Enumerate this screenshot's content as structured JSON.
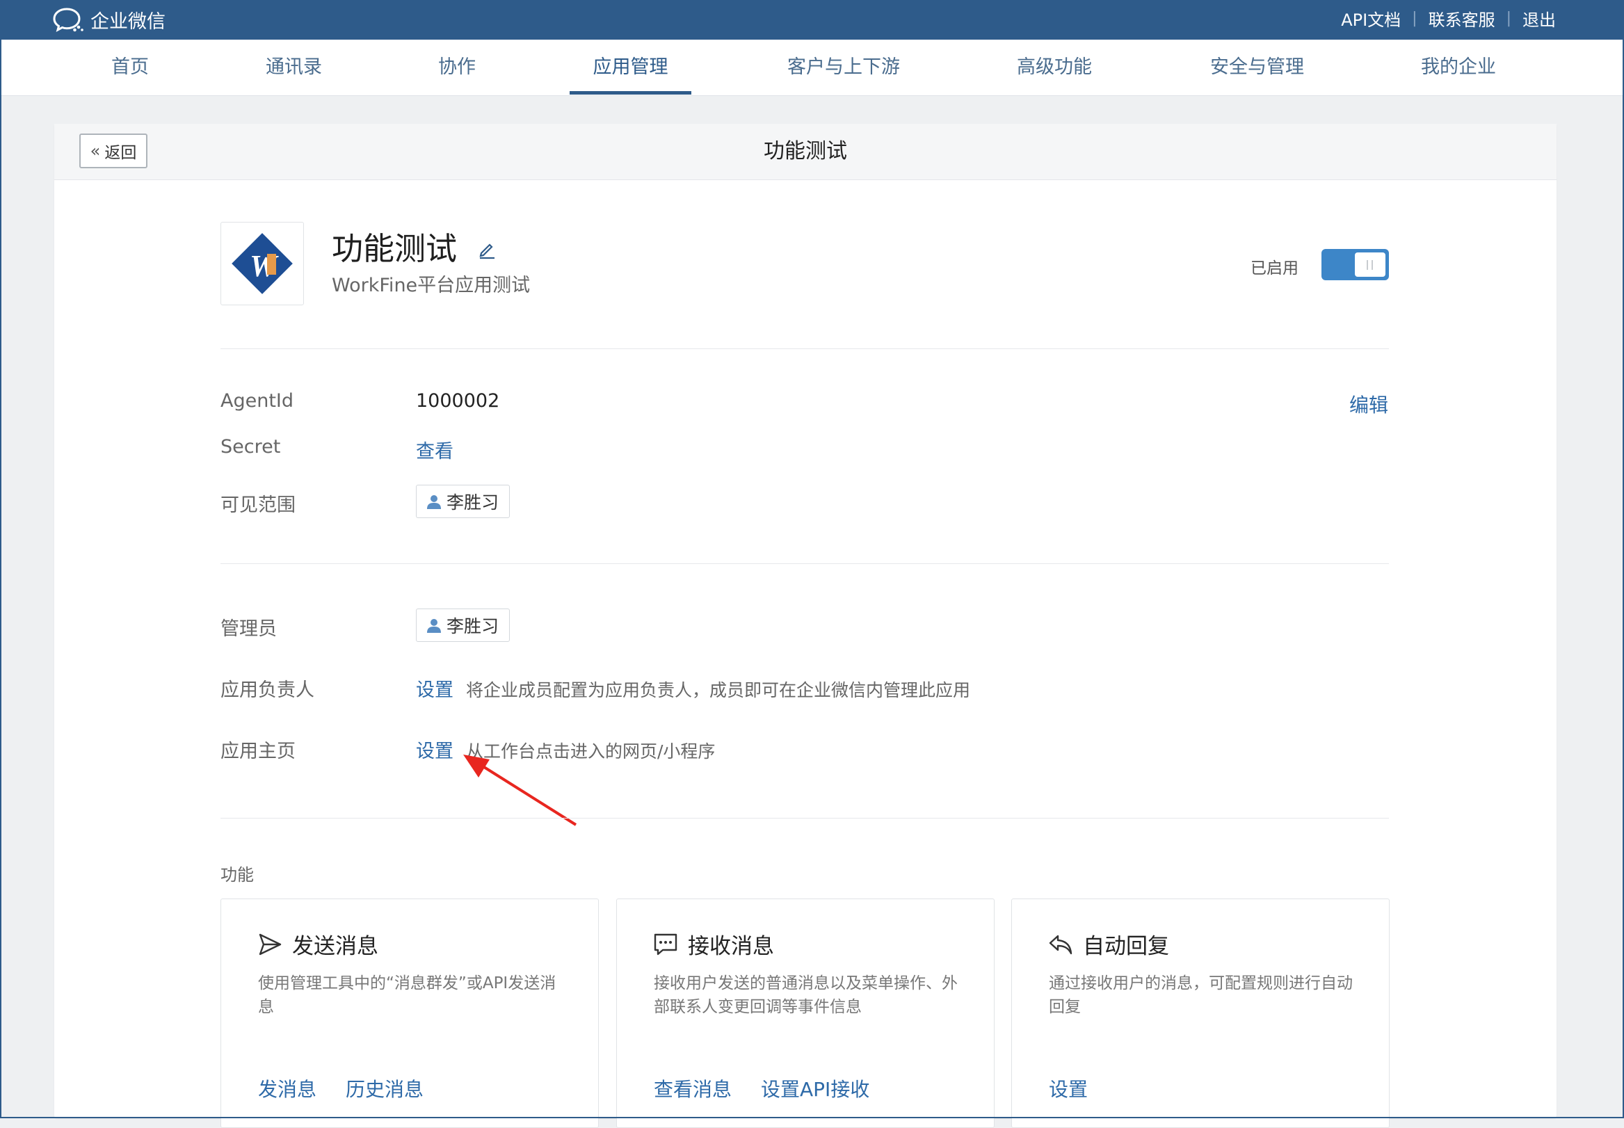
{
  "topbar": {
    "brand": "企业微信",
    "links": [
      "API文档",
      "联系客服",
      "退出"
    ]
  },
  "nav": {
    "items": [
      "首页",
      "通讯录",
      "协作",
      "应用管理",
      "客户与上下游",
      "高级功能",
      "安全与管理",
      "我的企业"
    ],
    "active": "应用管理"
  },
  "page": {
    "back_label": "返回",
    "title": "功能测试"
  },
  "app": {
    "name": "功能测试",
    "description": "WorkFine平台应用测试",
    "status_label": "已启用",
    "enabled": true,
    "logo_text": "W"
  },
  "details": {
    "agentid_label": "AgentId",
    "agentid_value": "1000002",
    "edit_label": "编辑",
    "secret_label": "Secret",
    "secret_action": "查看",
    "visible_label": "可见范围",
    "visible_user": "李胜习"
  },
  "admin": {
    "admin_label": "管理员",
    "admin_user": "李胜习",
    "owner_label": "应用负责人",
    "owner_action": "设置",
    "owner_hint": "将企业成员配置为应用负责人，成员即可在企业微信内管理此应用",
    "homepage_label": "应用主页",
    "homepage_action": "设置",
    "homepage_hint": "从工作台点击进入的网页/小程序"
  },
  "features": {
    "section_label": "功能",
    "cards": [
      {
        "title": "发送消息",
        "icon": "send-icon",
        "desc": "使用管理工具中的“消息群发”或API发送消息",
        "actions": [
          "发消息",
          "历史消息"
        ]
      },
      {
        "title": "接收消息",
        "icon": "chat-icon",
        "desc": "接收用户发送的普通消息以及菜单操作、外部联系人变更回调等事件信息",
        "actions": [
          "查看消息",
          "设置API接收"
        ]
      },
      {
        "title": "自动回复",
        "icon": "reply-icon",
        "desc": "通过接收用户的消息，可配置规则进行自动回复",
        "actions": [
          "设置"
        ]
      }
    ]
  },
  "colors": {
    "topbar": "#2e5b8a",
    "link": "#2e6aa8",
    "toggle": "#3d86c8",
    "annotation_arrow": "#e8261f"
  }
}
